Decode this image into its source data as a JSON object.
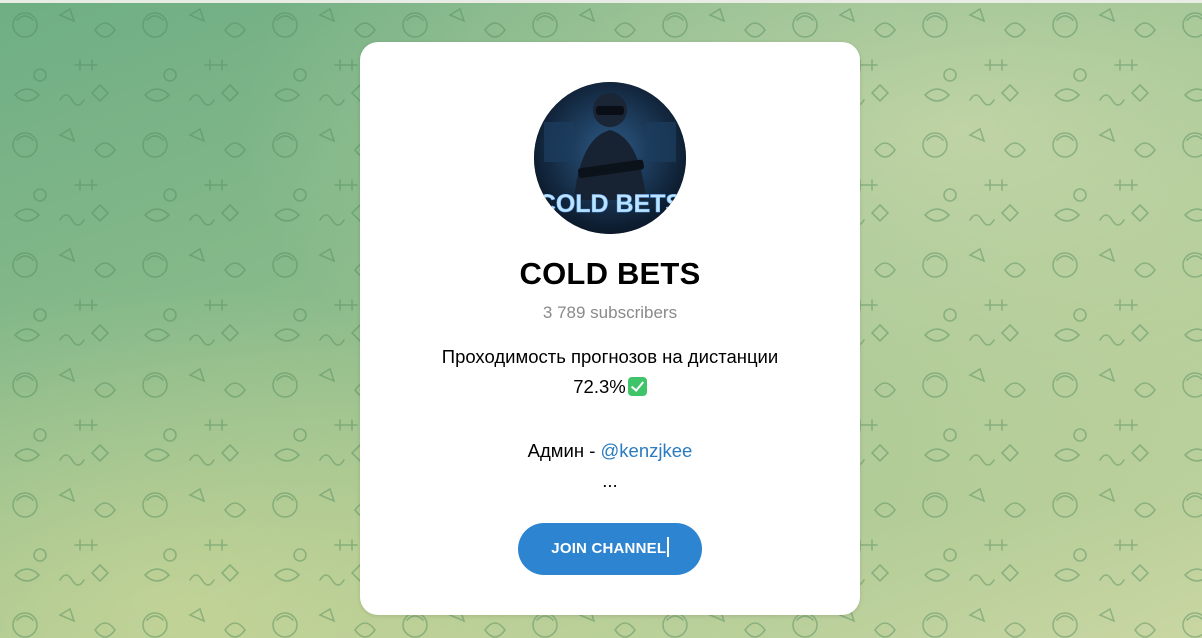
{
  "channel": {
    "name": "COLD BETS",
    "subscribers": "3 789 subscribers",
    "description_line1": "Проходимость прогнозов на дистанции",
    "description_line2": "72.3%",
    "admin_prefix": "Админ - ",
    "admin_handle": "@kenzjkee",
    "ellipsis": "...",
    "avatar_text": "COLD BETS"
  },
  "actions": {
    "join_label": "JOIN CHANNEL"
  },
  "icons": {
    "check": "check-mark-emoji-icon"
  },
  "colors": {
    "accent": "#2d84d0",
    "link": "#2a7bbf",
    "check": "#3fc46a",
    "background": "#86b98a"
  }
}
